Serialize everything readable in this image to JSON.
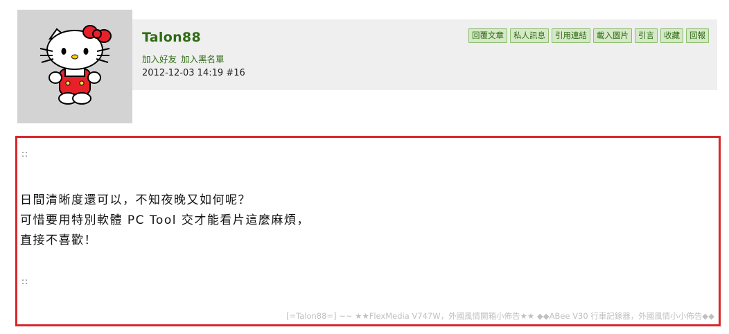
{
  "user": {
    "name": "Talon88",
    "links": [
      "加入好友",
      "加入黑名單"
    ],
    "date": "2012-12-03 14:19",
    "floor": "#16"
  },
  "actions": [
    "回覆文章",
    "私人訊息",
    "引用連結",
    "載入圖片",
    "引言",
    "收藏",
    "回報"
  ],
  "post": {
    "dots_top": "::",
    "lines": [
      "日間清晰度還可以，不知夜晚又如何呢？",
      "可惜要用特別軟體 PC Tool 交才能看片這麼麻煩，",
      "直接不喜歡！"
    ],
    "dots_bottom": "::",
    "signature": "[=Talon88=] ~~ ★★FlexMedia V747W，外國風情開箱小佈告★★ ◆◆ABee V30 行車記錄器，外國風情小小佈告◆◆"
  },
  "colors": {
    "accent_green": "#2f6b14",
    "button_bg": "#d5e8c8",
    "highlight_border": "#d9262b"
  },
  "icons": {
    "avatar": "hello-kitty-avatar"
  }
}
